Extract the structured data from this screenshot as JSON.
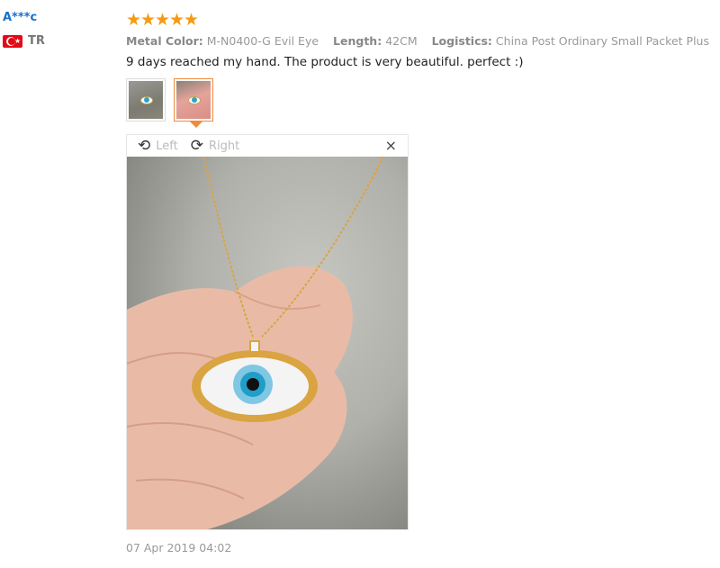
{
  "user": {
    "name": "A***c",
    "country_code": "TR",
    "flag_icon": "turkey-flag-icon"
  },
  "review": {
    "rating": 5,
    "star_icons": [
      "★",
      "★",
      "★",
      "★",
      "★"
    ],
    "attributes": [
      {
        "key": "Metal Color:",
        "value": "M-N0400-G Evil Eye"
      },
      {
        "key": "Length:",
        "value": "42CM"
      },
      {
        "key": "Logistics:",
        "value": "China Post Ordinary Small Packet Plus"
      }
    ],
    "text": "9 days reached my hand. The product is very beautiful. perfect :)",
    "date": "07 Apr 2019 04:02"
  },
  "viewer": {
    "rotate_left_label": "Left",
    "rotate_right_label": "Right",
    "close_symbol": "×",
    "rotate_left_icon": "⟲",
    "rotate_right_icon": "⟳"
  },
  "colors": {
    "accent": "#f08a3c",
    "star": "#f39c12",
    "username": "#1a6fcc"
  }
}
